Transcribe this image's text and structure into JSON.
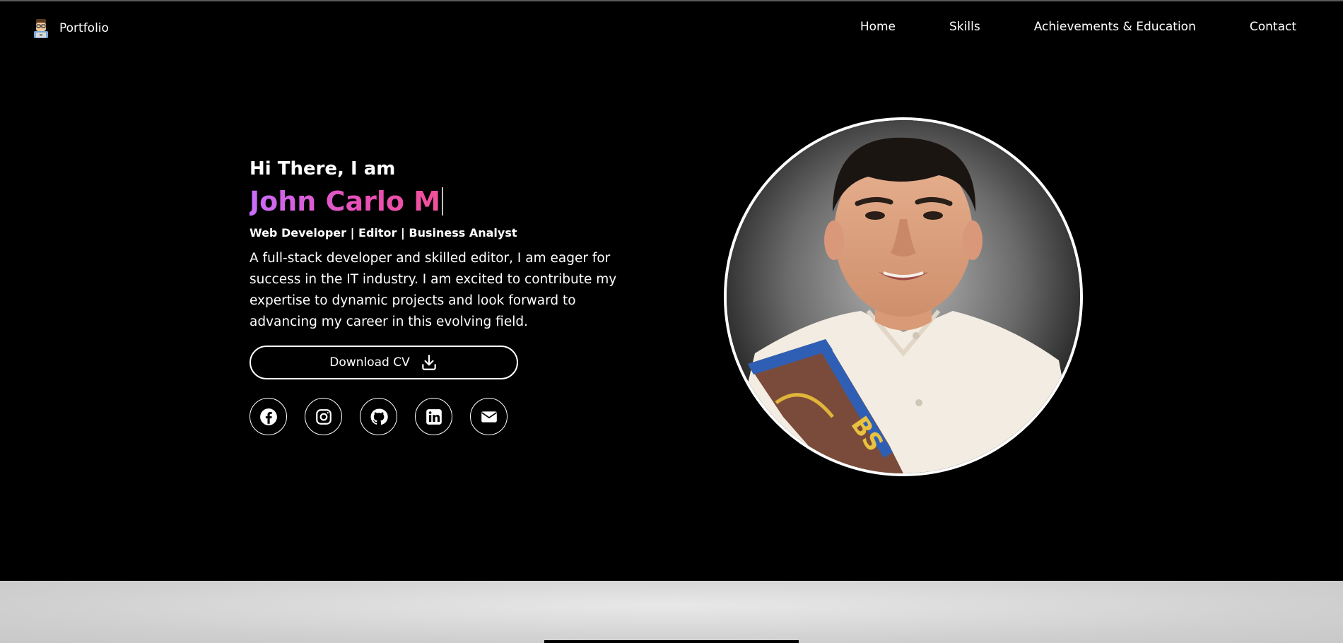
{
  "nav": {
    "brand_label": "Portfolio",
    "links": [
      "Home",
      "Skills",
      "Achievements & Education",
      "Contact"
    ]
  },
  "hero": {
    "greeting": "Hi There, I am",
    "name_typed": "John Carlo M",
    "roles": "Web Developer | Editor | Business Analyst",
    "bio": "A full-stack developer and skilled editor, I am eager for success in the IT industry. I am excited to contribute my expertise to dynamic projects and look forward to advancing my career in this evolving field.",
    "cv_label": "Download CV",
    "socials": [
      "facebook-icon",
      "instagram-icon",
      "github-icon",
      "linkedin-icon",
      "envelope-icon"
    ]
  },
  "colors": {
    "background": "#000000",
    "name_gradient_start": "#c86dfa",
    "name_gradient_end": "#f0509a",
    "next_section": "#d4d4d4"
  }
}
